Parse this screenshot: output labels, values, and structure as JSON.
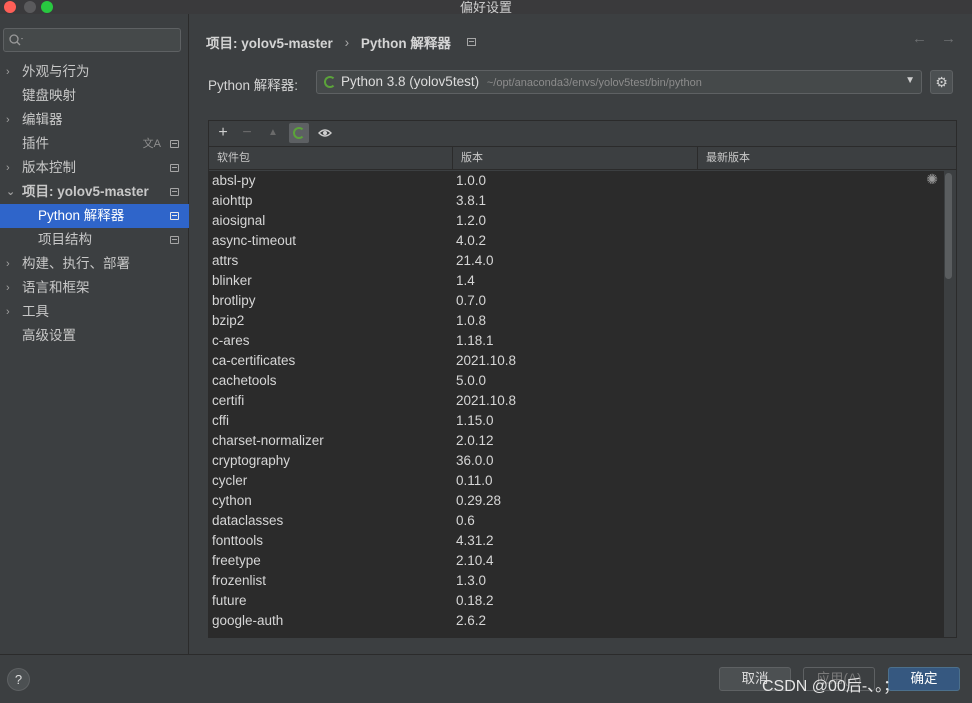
{
  "window": {
    "title": "偏好设置"
  },
  "sidebar": {
    "search_placeholder": "",
    "items": [
      {
        "label": "外观与行为",
        "chevron": true,
        "sub": false,
        "badge": false,
        "translate": false
      },
      {
        "label": "键盘映射",
        "chevron": false,
        "sub": false,
        "badge": false,
        "translate": false
      },
      {
        "label": "编辑器",
        "chevron": true,
        "sub": false,
        "badge": false,
        "translate": false
      },
      {
        "label": "插件",
        "chevron": false,
        "sub": false,
        "badge": true,
        "translate": true
      },
      {
        "label": "版本控制",
        "chevron": true,
        "sub": false,
        "badge": true,
        "translate": false
      },
      {
        "label": "项目: yolov5-master",
        "chevron": true,
        "expanded": true,
        "sub": false,
        "badge": true,
        "translate": false
      },
      {
        "label": "Python 解释器",
        "chevron": false,
        "sub": true,
        "badge": true,
        "translate": false,
        "selected": true
      },
      {
        "label": "项目结构",
        "chevron": false,
        "sub": true,
        "badge": true,
        "translate": false
      },
      {
        "label": "构建、执行、部署",
        "chevron": true,
        "sub": false,
        "badge": false,
        "translate": false
      },
      {
        "label": "语言和框架",
        "chevron": true,
        "sub": false,
        "badge": false,
        "translate": false
      },
      {
        "label": "工具",
        "chevron": true,
        "sub": false,
        "badge": false,
        "translate": false
      },
      {
        "label": "高级设置",
        "chevron": false,
        "sub": false,
        "badge": false,
        "translate": false
      }
    ]
  },
  "breadcrumb": {
    "project": "项目: yolov5-master",
    "separator": "›",
    "page": "Python 解释器"
  },
  "interpreter": {
    "label": "Python 解释器:",
    "name": "Python 3.8 (yolov5test)",
    "path": "~/opt/anaconda3/envs/yolov5test/bin/python"
  },
  "toolbar": {
    "add": "+",
    "remove": "−",
    "upgrade": "▲",
    "eye": "👁"
  },
  "table": {
    "headers": [
      "软件包",
      "版本",
      "最新版本"
    ],
    "rows": [
      [
        "absl-py",
        "1.0.0"
      ],
      [
        "aiohttp",
        "3.8.1"
      ],
      [
        "aiosignal",
        "1.2.0"
      ],
      [
        "async-timeout",
        "4.0.2"
      ],
      [
        "attrs",
        "21.4.0"
      ],
      [
        "blinker",
        "1.4"
      ],
      [
        "brotlipy",
        "0.7.0"
      ],
      [
        "bzip2",
        "1.0.8"
      ],
      [
        "c-ares",
        "1.18.1"
      ],
      [
        "ca-certificates",
        "2021.10.8"
      ],
      [
        "cachetools",
        "5.0.0"
      ],
      [
        "certifi",
        "2021.10.8"
      ],
      [
        "cffi",
        "1.15.0"
      ],
      [
        "charset-normalizer",
        "2.0.12"
      ],
      [
        "cryptography",
        "36.0.0"
      ],
      [
        "cycler",
        "0.11.0"
      ],
      [
        "cython",
        "0.29.28"
      ],
      [
        "dataclasses",
        "0.6"
      ],
      [
        "fonttools",
        "4.31.2"
      ],
      [
        "freetype",
        "2.10.4"
      ],
      [
        "frozenlist",
        "1.3.0"
      ],
      [
        "future",
        "0.18.2"
      ],
      [
        "google-auth",
        "2.6.2"
      ]
    ]
  },
  "footer": {
    "help": "?",
    "cancel": "取消",
    "apply": "应用(A)",
    "ok": "确定",
    "watermark": "CSDN @00后-、。；"
  },
  "colors": {
    "accent": "#2f65ca",
    "ok_button": "#365880",
    "ring": "#5ba33a"
  }
}
